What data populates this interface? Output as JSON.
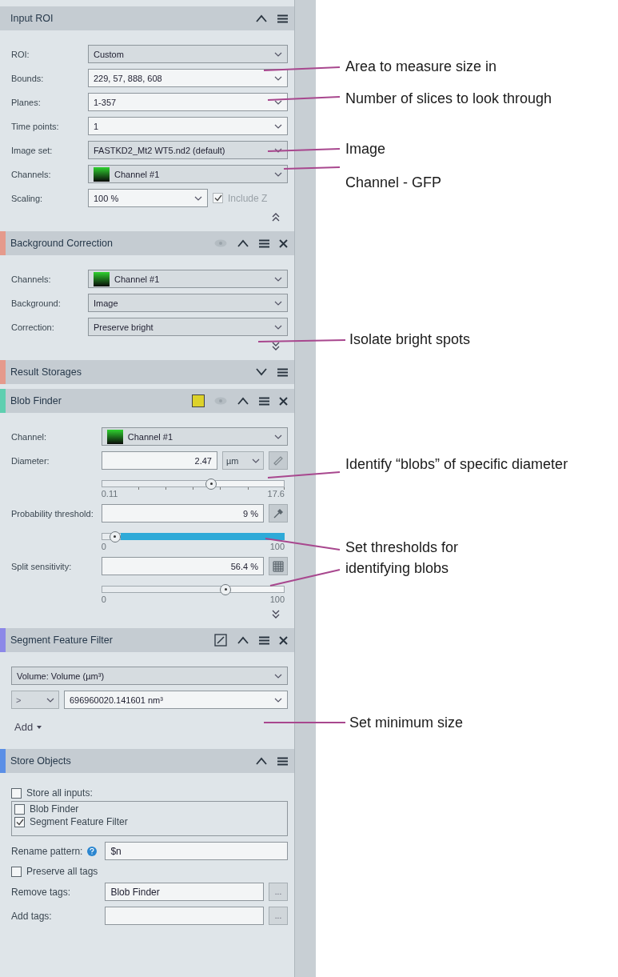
{
  "sections": [
    {
      "title": "Input ROI",
      "expanded": true,
      "header_icons": [
        {
          "kind": "collapse"
        },
        {
          "kind": "menu"
        }
      ],
      "more_expanded": true,
      "rows": [
        {
          "kind": "select",
          "label": "ROI:",
          "value": "Custom",
          "editable": false
        },
        {
          "kind": "select",
          "label": "Bounds:",
          "value": "229, 57, 888, 608",
          "editable": true
        },
        {
          "kind": "select",
          "label": "Planes:",
          "value": "1-357",
          "editable": true
        },
        {
          "kind": "select",
          "label": "Time points:",
          "value": "1",
          "editable": true
        },
        {
          "kind": "select",
          "label": "Image set:",
          "value": "FASTKD2_Mt2 WT5.nd2 (default)",
          "editable": false
        },
        {
          "kind": "select",
          "label": "Channels:",
          "value": "Channel #1",
          "swatch": true,
          "editable": false
        },
        {
          "kind": "select_check",
          "label": "Scaling:",
          "value": "100 %",
          "check_label": "Include Z",
          "checked": true,
          "disabled": true
        }
      ]
    },
    {
      "title": "Background Correction",
      "color": "#e59a8c",
      "expanded": true,
      "header_icons": [
        {
          "kind": "eye"
        },
        {
          "kind": "collapse"
        },
        {
          "kind": "menu"
        },
        {
          "kind": "close"
        }
      ],
      "more_expanded": false,
      "rows": [
        {
          "kind": "select",
          "label": "Channels:",
          "value": "Channel #1",
          "swatch": true,
          "editable": false
        },
        {
          "kind": "select",
          "label": "Background:",
          "value": "Image",
          "editable": false
        },
        {
          "kind": "select",
          "label": "Correction:",
          "value": "Preserve bright",
          "editable": false
        }
      ]
    },
    {
      "title": "Result Storages",
      "color": "#e59a8c",
      "expanded": false,
      "header_icons": [
        {
          "kind": "toggle"
        },
        {
          "kind": "menu"
        }
      ]
    },
    {
      "title": "Blob Finder",
      "color": "#5fcfb0",
      "expanded": true,
      "header_icons": [
        {
          "kind": "swatch"
        },
        {
          "kind": "eye"
        },
        {
          "kind": "toggle"
        },
        {
          "kind": "menu"
        },
        {
          "kind": "close"
        }
      ],
      "more_expanded": false,
      "rows": [
        {
          "kind": "select",
          "label": "Channel:",
          "value": "Channel #1",
          "swatch": true,
          "editable": false
        },
        {
          "kind": "number_slider",
          "label": "Diameter:",
          "value": "2.47",
          "unit": "µm",
          "tool": {
            "kind": "ruler"
          },
          "level": 0.6,
          "min": "0.11",
          "max": "17.6",
          "ticks": true,
          "filled": false
        },
        {
          "kind": "number_slider",
          "label": "Probability threshold:",
          "value": "9 %",
          "tool": {
            "kind": "picker"
          },
          "level": 0.07,
          "min": "0",
          "max": "100",
          "ticks": false,
          "filled": true
        },
        {
          "kind": "number_slider",
          "label": "Split sensitivity:",
          "value": "56.4 %",
          "tool": {
            "kind": "grid"
          },
          "level": 0.68,
          "min": "0",
          "max": "100",
          "ticks": false,
          "filled": false
        }
      ]
    },
    {
      "title": "Segment Feature Filter",
      "color": "#8c88e8",
      "expanded": true,
      "header_icons": [
        {
          "kind": "edit"
        },
        {
          "kind": "toggle"
        },
        {
          "kind": "menu"
        },
        {
          "kind": "close"
        }
      ],
      "rows": [
        {
          "kind": "full_select",
          "value": "Volume: Volume (µm³)"
        },
        {
          "kind": "compare",
          "operator": ">",
          "value": "696960020.141601 nm³"
        },
        {
          "kind": "menu_button",
          "label": "Add"
        }
      ]
    },
    {
      "title": "Store Objects",
      "color": "#5b8fe6",
      "expanded": true,
      "header_icons": [
        {
          "kind": "toggle"
        },
        {
          "kind": "menu"
        }
      ],
      "rows": [
        {
          "kind": "checkbox",
          "label": "Store all inputs:",
          "checked": false
        },
        {
          "kind": "checklist",
          "items": [
            {
              "label": "Blob Finder",
              "checked": false
            },
            {
              "label": "Segment Feature Filter",
              "checked": true
            }
          ]
        },
        {
          "kind": "text",
          "label": "Rename pattern:",
          "value": "$n",
          "help": true
        },
        {
          "kind": "checkbox",
          "label": "Preserve all tags",
          "checked": false
        },
        {
          "kind": "text",
          "label": "Remove tags:",
          "value": "Blob Finder",
          "browse": "..."
        },
        {
          "kind": "text",
          "label": "Add tags:",
          "browse": "..."
        }
      ]
    }
  ],
  "annotations": [
    {
      "text": "Area to measure size in"
    },
    {
      "text": "Number of slices to look through"
    },
    {
      "text": "Image"
    },
    {
      "text": "Channel - GFP"
    },
    {
      "text": "Isolate bright spots"
    },
    {
      "text": "Identify “blobs” of specific diameter"
    },
    {
      "text": "Set thresholds for identifying blobs"
    },
    {
      "text": "Set minimum size"
    }
  ]
}
